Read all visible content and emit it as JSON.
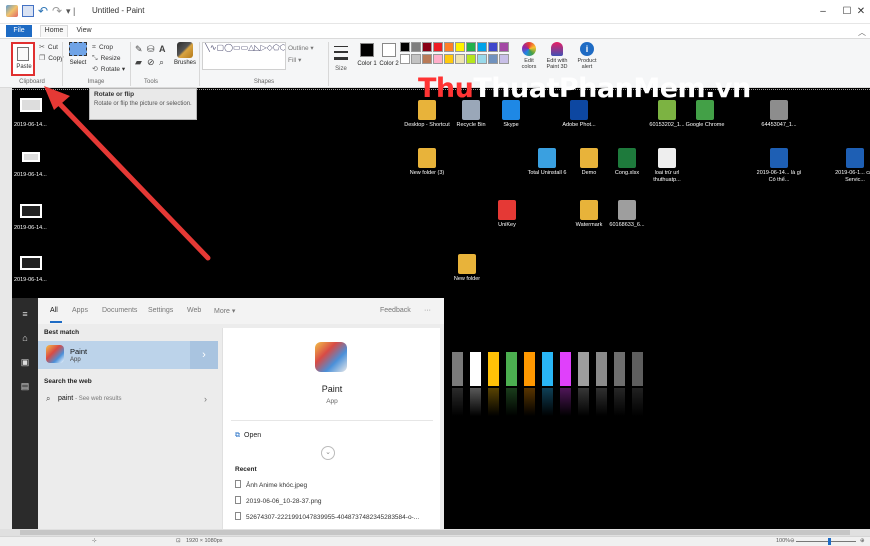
{
  "window": {
    "title": "Untitled - Paint",
    "quick_access": [
      "paint-app",
      "save",
      "undo",
      "redo",
      "customize"
    ],
    "controls": {
      "minimize": "–",
      "maximize": "☐",
      "close": "✕"
    }
  },
  "ribbon": {
    "tabs": [
      {
        "label": "File",
        "active": false,
        "accent": "#1e6bc4"
      },
      {
        "label": "Home",
        "active": true
      },
      {
        "label": "View",
        "active": false
      }
    ],
    "clipboard": {
      "paste": "Paste",
      "cut": "Cut",
      "copy": "Copy",
      "group_label": "Clipboard"
    },
    "image": {
      "select": "Select",
      "crop": "Crop",
      "resize": "Resize",
      "rotate": "Rotate ▾",
      "group_label": "Image"
    },
    "tools": {
      "group_label": "Tools",
      "items": [
        "pencil-icon",
        "fill-icon",
        "text-icon",
        "eraser-icon",
        "color-picker-icon",
        "magnifier-icon"
      ]
    },
    "brushes": "Brushes",
    "shapes": {
      "outline": "Outline ▾",
      "fill": "Fill ▾",
      "group_label": "Shapes",
      "glyphs": "╲∿▢◯▭▭△◺▷◇⬠⬡⇨⇦⇧⇩✦✧☆✩▭◯♡⚡▾"
    },
    "size": "Size",
    "color1": {
      "label": "Color 1",
      "value": "#000000"
    },
    "color2": {
      "label": "Color 2",
      "value": "#ffffff"
    },
    "palette": [
      "#000000",
      "#7f7f7f",
      "#880015",
      "#ed1c24",
      "#ff7f27",
      "#fff200",
      "#22b14c",
      "#00a2e8",
      "#3f48cc",
      "#a349a4",
      "#ffffff",
      "#c3c3c3",
      "#b97a57",
      "#ffaec9",
      "#ffc90e",
      "#efe4b0",
      "#b5e61d",
      "#99d9ea",
      "#7092be",
      "#c8bfe7"
    ],
    "edit_colors": "Edit colors",
    "edit_3d": "Edit with Paint 3D",
    "product_alert": "Product alert"
  },
  "tooltip": {
    "title": "Rotate or flip",
    "body": "Rotate or flip the picture or selection."
  },
  "watermark": {
    "part1": "Thu",
    "part2": "Thuat",
    "part3": "PhanMem.vn",
    "color_a": "#ff3333"
  },
  "desktop": {
    "thumbs": [
      "2019-06-14...",
      "2019-06-14...",
      "2019-06-14...",
      "2019-06-14..."
    ],
    "icons": [
      {
        "label": "Desktop - Shortcut",
        "color": "#e8b33a"
      },
      {
        "label": "Recycle Bin",
        "color": "#9aa7b8"
      },
      {
        "label": "Skype",
        "color": "#1e88e5"
      },
      {
        "label": "Adobe Phot...",
        "color": "#0d47a1"
      },
      {
        "label": "60153202_1...",
        "color": "#7cb342"
      },
      {
        "label": "Google Chrome",
        "color": "#43a047"
      },
      {
        "label": "64453047_1...",
        "color": "#8d8d8d"
      },
      {
        "label": "New folder (3)",
        "color": "#e8b33a"
      },
      {
        "label": "Total Uninstall 6",
        "color": "#3aa0e0"
      },
      {
        "label": "Demo",
        "color": "#e8b33a"
      },
      {
        "label": "Cong.xlsx",
        "color": "#1e7a3c"
      },
      {
        "label": "loai trừ url thuthuatp...",
        "color": "#eeeeee"
      },
      {
        "label": "2019-06-14... là gì Có thể...",
        "color": "#1e5fb4"
      },
      {
        "label": "2019-06-1... các Servic...",
        "color": "#1e5fb4"
      },
      {
        "label": "UniKey",
        "color": "#e53935"
      },
      {
        "label": "Watermark",
        "color": "#e8b33a"
      },
      {
        "label": "60168633_6...",
        "color": "#9e9e9e"
      },
      {
        "label": "New folder",
        "color": "#e8b33a"
      }
    ],
    "bars": [
      "#7a7a7a",
      "#ffffff",
      "#ffc107",
      "#4caf50",
      "#ff9800",
      "#29b6f6",
      "#e040fb",
      "#9e9e9e",
      "#8a8a8a",
      "#6e6e6e",
      "#5e5e5e"
    ]
  },
  "start_menu": {
    "filters": [
      "All",
      "Apps",
      "Documents",
      "Settings",
      "Web",
      "More ▾"
    ],
    "feedback": "Feedback",
    "dots": "···",
    "best_match_header": "Best match",
    "best_match": {
      "name": "Paint",
      "type": "App"
    },
    "search_web_header": "Search the web",
    "web_query": "paint",
    "web_hint": "- See web results",
    "detail": {
      "name": "Paint",
      "type": "App",
      "open": "Open",
      "recent_header": "Recent"
    },
    "recent": [
      "Ảnh Anime khóc.jpeg",
      "2019-06-06_10-28-37.png",
      "52674307-2221991047839955-4048737482345283584-o-..."
    ]
  },
  "status": {
    "dims": "1920 × 1080px",
    "zoom": "100%"
  },
  "annotation": {
    "arrow_color": "#e53935"
  }
}
